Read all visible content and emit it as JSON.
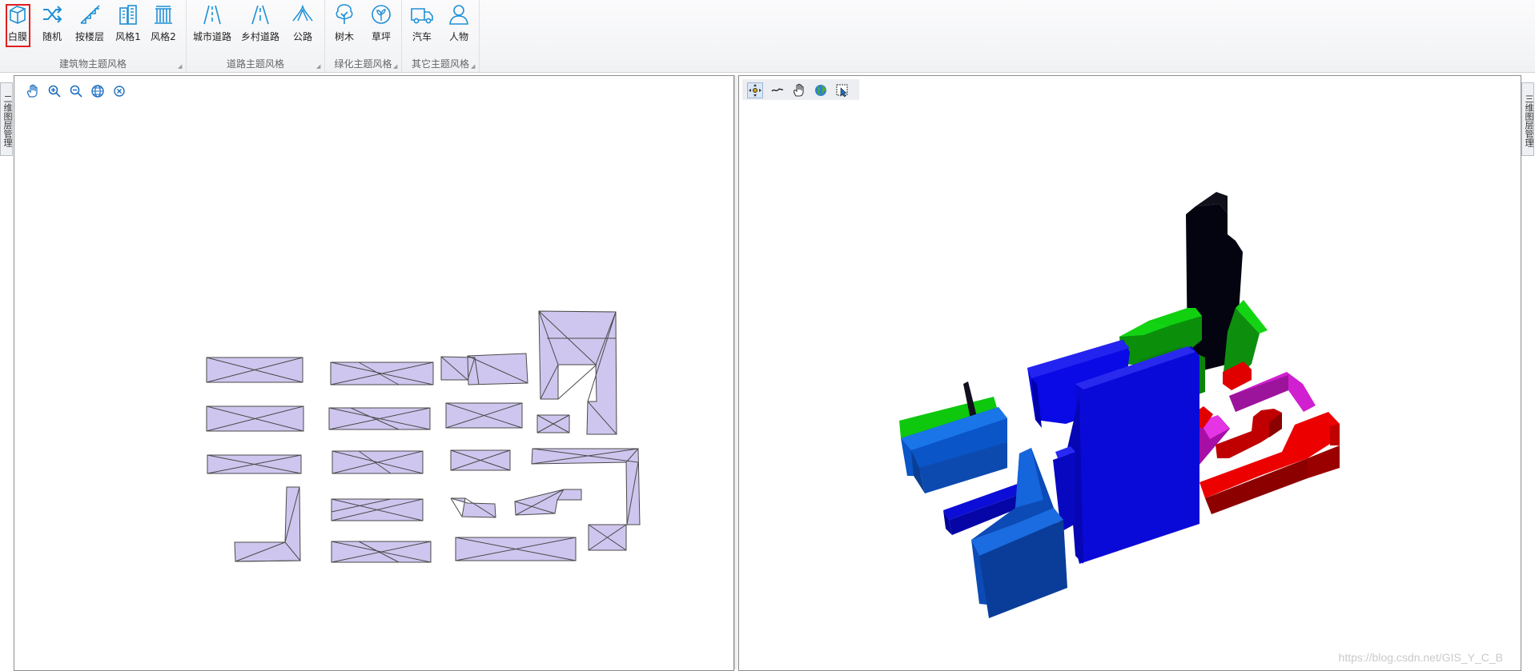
{
  "ribbon": {
    "groups": [
      {
        "label": "建筑物主题风格",
        "buttons": [
          {
            "label": "白膜",
            "icon": "cube-icon",
            "selected": true
          },
          {
            "label": "随机",
            "icon": "shuffle-icon"
          },
          {
            "label": "按楼层",
            "icon": "stairs-icon"
          },
          {
            "label": "风格1",
            "icon": "building-icon"
          },
          {
            "label": "风格2",
            "icon": "column-building-icon"
          }
        ]
      },
      {
        "label": "道路主题风格",
        "buttons": [
          {
            "label": "城市道路",
            "icon": "city-road-icon"
          },
          {
            "label": "乡村道路",
            "icon": "rural-road-icon"
          },
          {
            "label": "公路",
            "icon": "highway-icon"
          }
        ]
      },
      {
        "label": "绿化主题风格",
        "buttons": [
          {
            "label": "树木",
            "icon": "tree-icon"
          },
          {
            "label": "草坪",
            "icon": "lawn-icon"
          }
        ]
      },
      {
        "label": "其它主题风格",
        "buttons": [
          {
            "label": "汽车",
            "icon": "truck-icon"
          },
          {
            "label": "人物",
            "icon": "person-icon"
          }
        ]
      }
    ]
  },
  "left_panel": {
    "side_tab": "二维图层管理",
    "tools": [
      "pan-hand-icon",
      "zoom-in-icon",
      "zoom-out-icon",
      "globe-icon",
      "clear-icon"
    ]
  },
  "right_panel": {
    "side_tab": "三维图层管理",
    "tools": [
      "navigate-icon",
      "fly-path-icon",
      "pan-hand-icon",
      "earth-icon",
      "select-icon"
    ]
  },
  "watermark": "https://blog.csdn.net/GIS_Y_C_B",
  "colors": {
    "accent": "#1e90d6",
    "building_2d": "#cfc6ef",
    "selected_border": "#e02020"
  }
}
